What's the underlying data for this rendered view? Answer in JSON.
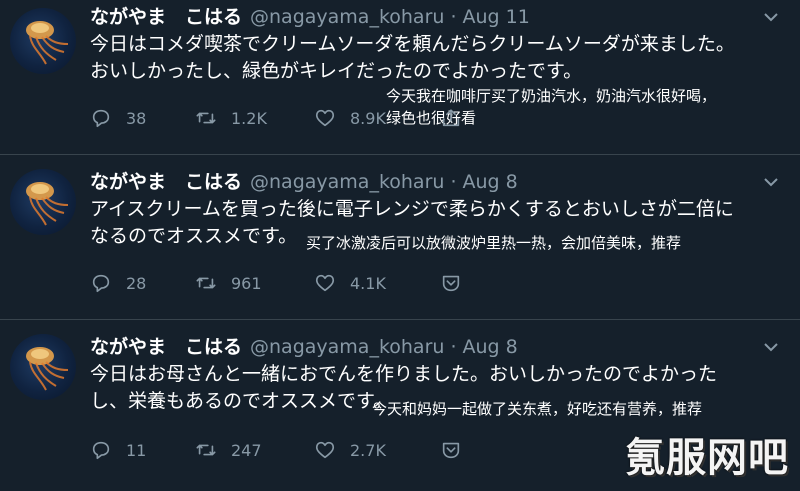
{
  "tweets": [
    {
      "name": "ながやま　こはる",
      "handle": "@nagayama_koharu",
      "separator": "·",
      "date": "Aug 11",
      "text": "今日はコメダ喫茶でクリームソーダを頼んだらクリームソーダが来ました。\nおいしかったし、緑色がキレイだったのでよかったです。",
      "translation": "今天我在咖啡厅买了奶油汽水，奶油汽水很好喝，\n绿色也很好看",
      "replies": "38",
      "retweets": "1.2K",
      "likes": "8.9K",
      "share_icon": "share-upload-icon"
    },
    {
      "name": "ながやま　こはる",
      "handle": "@nagayama_koharu",
      "separator": "·",
      "date": "Aug 8",
      "text": "アイスクリームを買った後に電子レンジで柔らかくするとおいしさが二倍に\nなるのでオススメです。",
      "translation": "买了冰激凌后可以放微波炉里热一热，会加倍美味，推荐",
      "replies": "28",
      "retweets": "961",
      "likes": "4.1K",
      "share_icon": "share-download-icon"
    },
    {
      "name": "ながやま　こはる",
      "handle": "@nagayama_koharu",
      "separator": "·",
      "date": "Aug 8",
      "text": "今日はお母さんと一緒におでんを作りました。おいしかったのでよかった\nし、栄養もあるのでオススメです。",
      "translation": "今天和妈妈一起做了关东煮，好吃还有营养，推荐",
      "replies": "11",
      "retweets": "247",
      "likes": "2.7K",
      "share_icon": "share-download-icon"
    }
  ],
  "watermark": "氪服网吧",
  "colors": {
    "background": "#15202b",
    "divider": "#38444d",
    "muted": "#8899a6",
    "text": "#ffffff"
  }
}
